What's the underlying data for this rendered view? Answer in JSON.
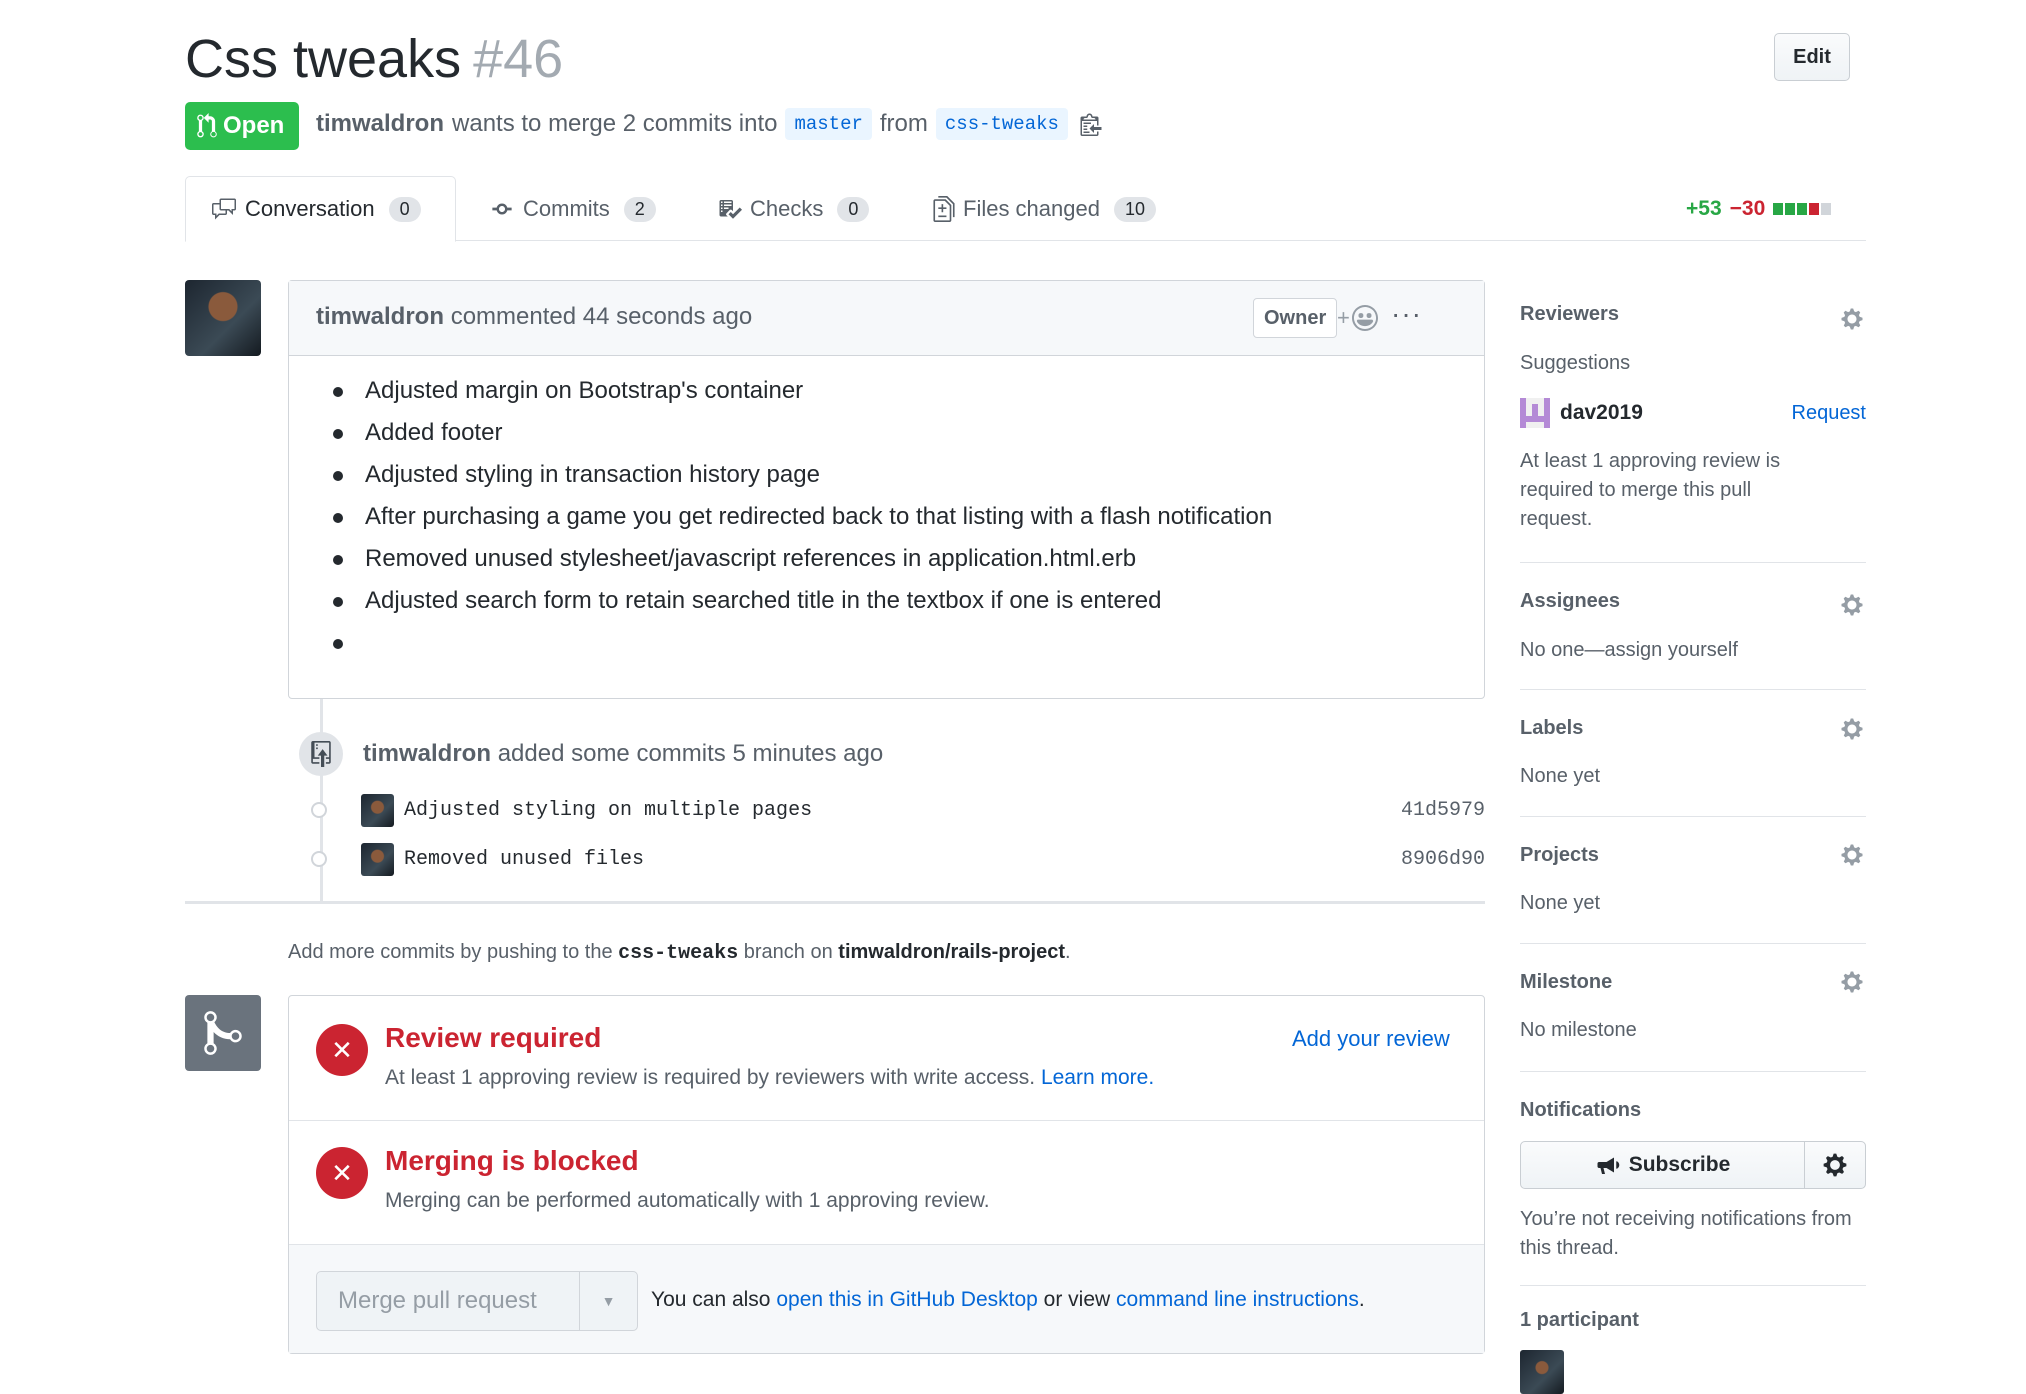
{
  "pr": {
    "title": "Css tweaks",
    "number": "#46",
    "edit_label": "Edit",
    "state_label": "Open",
    "author": "timwaldron",
    "merge_text": "wants to merge 2 commits into",
    "base_branch": "master",
    "from_text": "from",
    "head_branch": "css-tweaks"
  },
  "tabs": [
    {
      "label": "Conversation",
      "count": "0",
      "icon": "comment-discussion-icon"
    },
    {
      "label": "Commits",
      "count": "2",
      "icon": "git-commit-icon"
    },
    {
      "label": "Checks",
      "count": "0",
      "icon": "checklist-icon"
    },
    {
      "label": "Files changed",
      "count": "10",
      "icon": "file-diff-icon"
    }
  ],
  "diffstat": {
    "additions": "+53",
    "deletions": "−30",
    "colors": [
      "#28a745",
      "#28a745",
      "#28a745",
      "#cb2431",
      "#d1d5da"
    ]
  },
  "comment": {
    "author": "timwaldron",
    "action": "commented 44 seconds ago",
    "badge": "Owner",
    "reaction_plus": "+",
    "items": [
      "Adjusted margin on Bootstrap's container",
      "Added footer",
      "Adjusted styling in transaction history page",
      "After purchasing a game you get redirected back to that listing with a flash notification",
      "Removed unused stylesheet/javascript references in application.html.erb",
      "Adjusted search form to retain searched title in the textbox if one is entered",
      ""
    ]
  },
  "event": {
    "author": "timwaldron",
    "action": "added some commits 5 minutes ago",
    "commits": [
      {
        "message": "Adjusted styling on multiple pages",
        "sha": "41d5979"
      },
      {
        "message": "Removed unused files",
        "sha": "8906d90"
      }
    ]
  },
  "push_hint": {
    "prefix": "Add more commits by pushing to the",
    "branch": "css-tweaks",
    "middle": "branch on",
    "repo": "timwaldron/rails-project",
    "suffix": "."
  },
  "merge": {
    "review_title": "Review required",
    "review_desc": "At least 1 approving review is required by reviewers with write access.",
    "learn_more": "Learn more.",
    "add_review": "Add your review",
    "blocked_title": "Merging is blocked",
    "blocked_desc": "Merging can be performed automatically with 1 approving review.",
    "merge_button": "Merge pull request",
    "hint_prefix": "You can also",
    "hint_desktop": "open this in GitHub Desktop",
    "hint_middle": "or view",
    "hint_cli": "command line instructions",
    "hint_suffix": ".",
    "error_color": "#cb2431"
  },
  "sidebar": {
    "reviewers": {
      "heading": "Reviewers",
      "suggestions": "Suggestions",
      "suggested_user": "dav2019",
      "request_label": "Request",
      "note": "At least 1 approving review is required to merge this pull request."
    },
    "assignees": {
      "heading": "Assignees",
      "value": "No one—assign yourself"
    },
    "labels": {
      "heading": "Labels",
      "value": "None yet"
    },
    "projects": {
      "heading": "Projects",
      "value": "None yet"
    },
    "milestone": {
      "heading": "Milestone",
      "value": "No milestone"
    },
    "notifications": {
      "heading": "Notifications",
      "subscribe_label": "Subscribe",
      "note": "You’re not receiving notifications from this thread."
    },
    "participants": {
      "heading": "1 participant"
    }
  }
}
